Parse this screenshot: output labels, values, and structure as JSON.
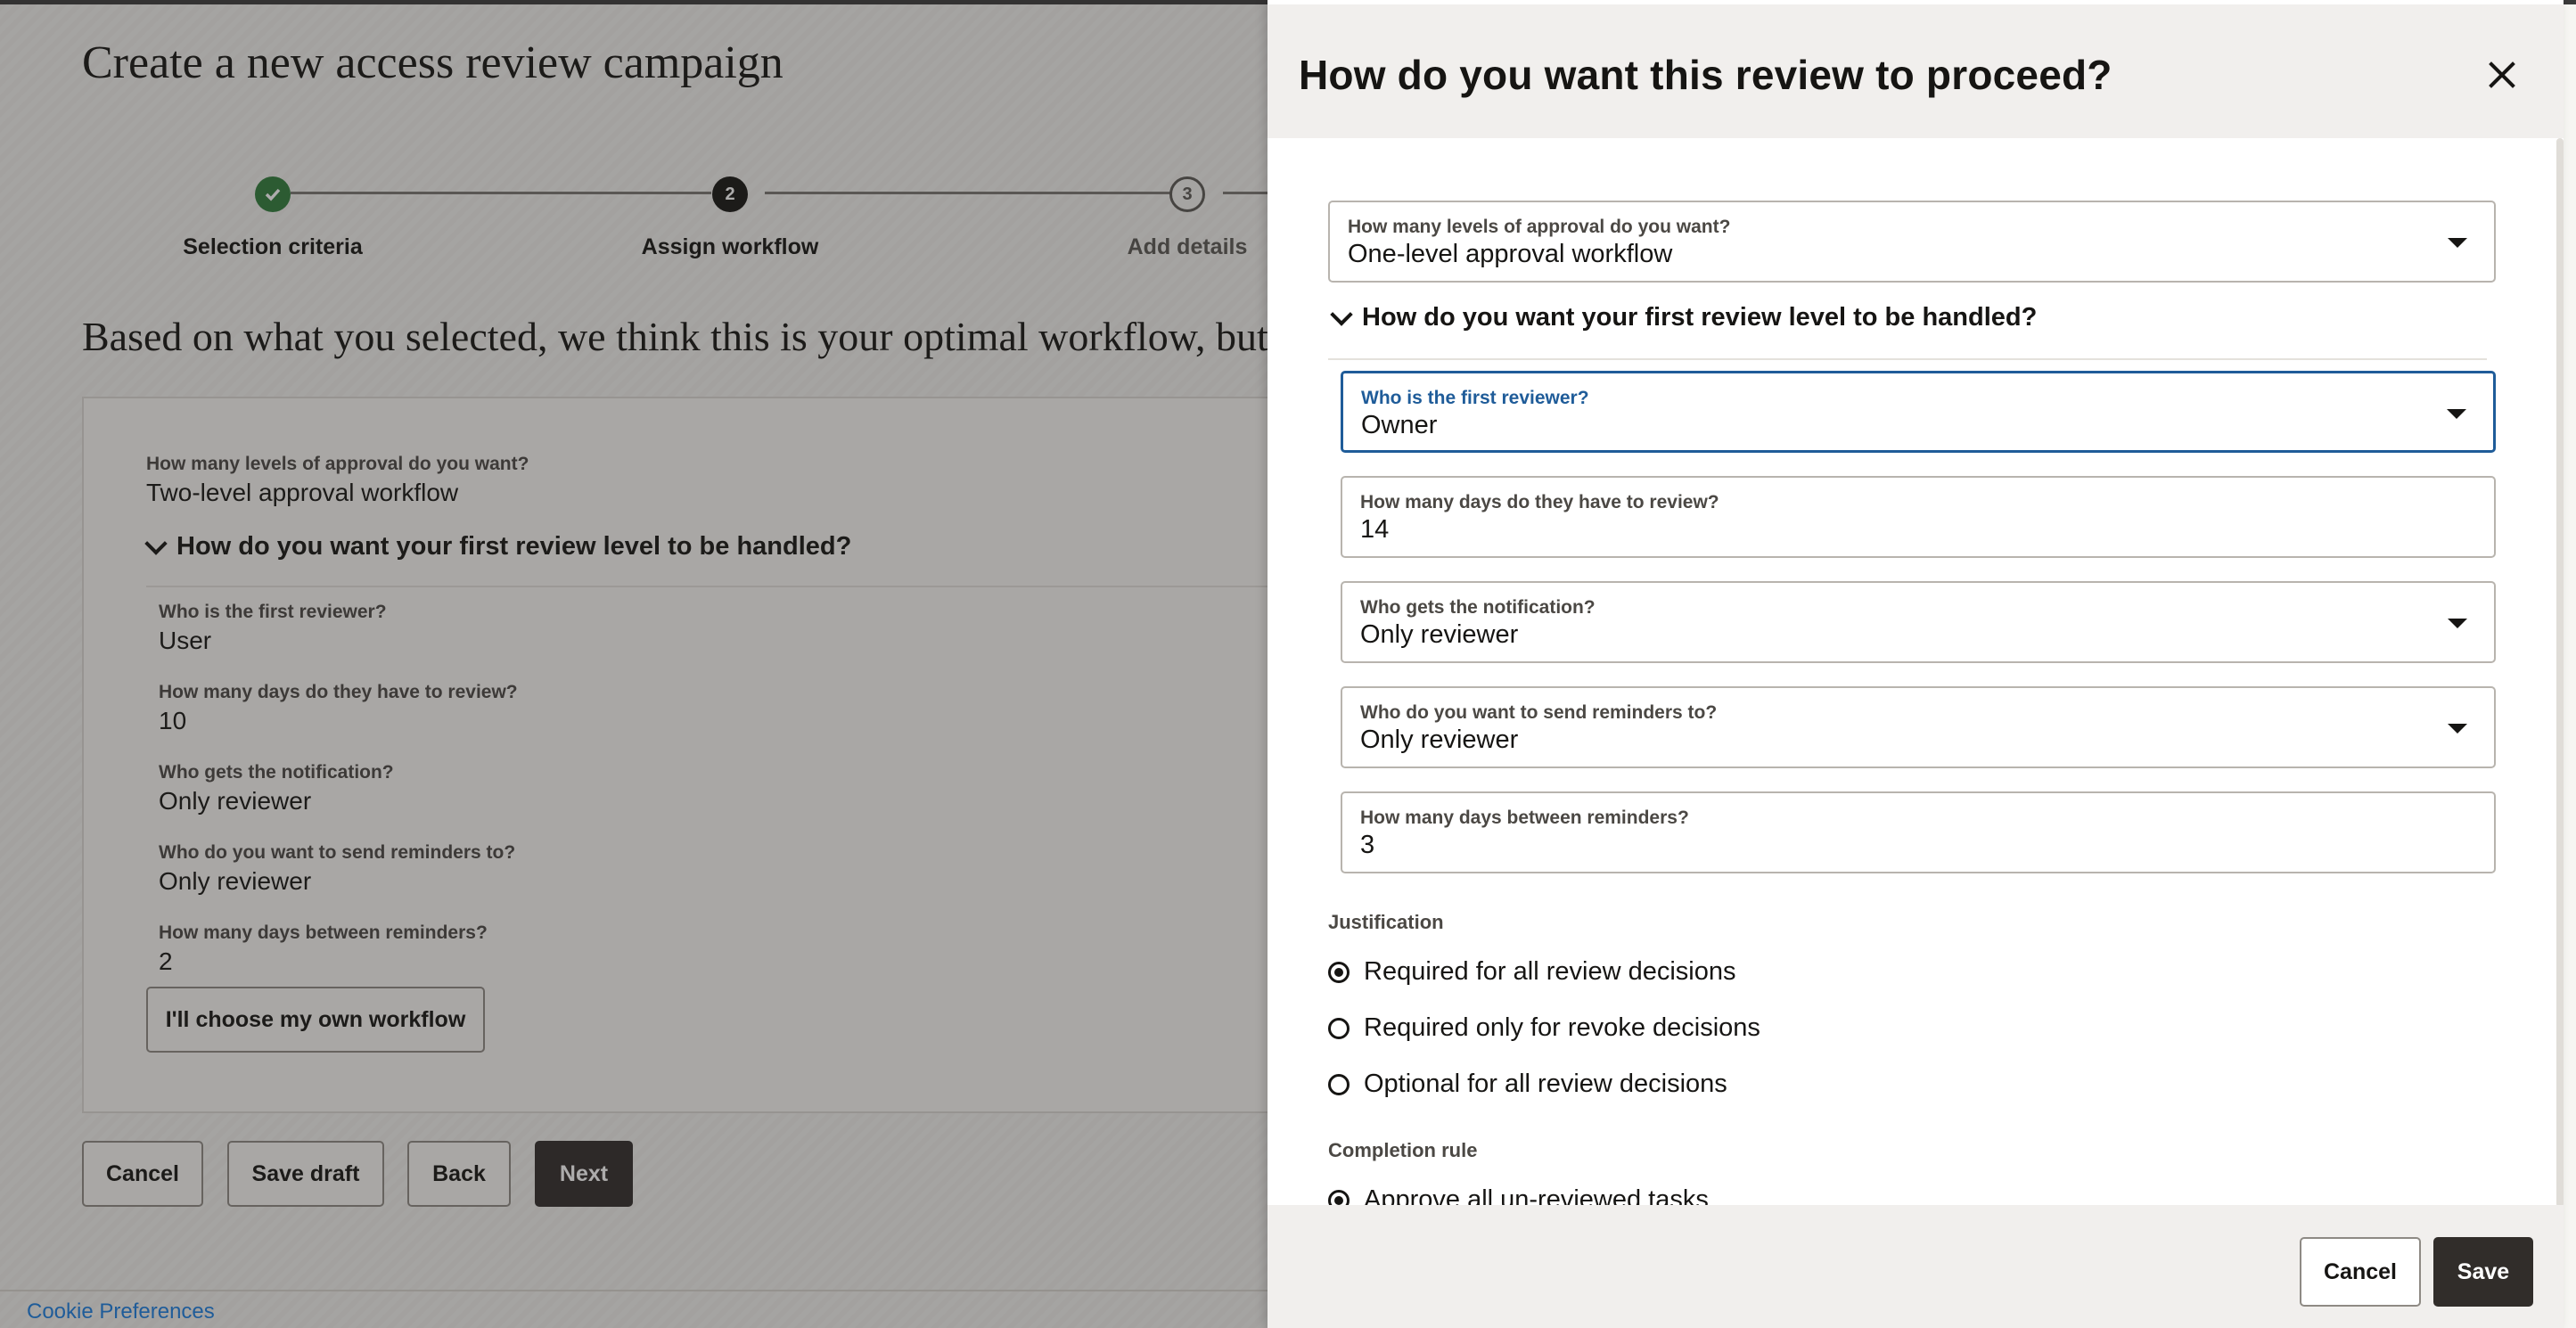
{
  "page": {
    "title": "Create a new access review campaign",
    "steps": [
      {
        "label": "Selection criteria",
        "state": "done",
        "number": ""
      },
      {
        "label": "Assign workflow",
        "state": "current",
        "number": "2"
      },
      {
        "label": "Add details",
        "state": "upcoming",
        "number": "3"
      }
    ],
    "intro": "Based on what you selected, we think this is your optimal workflow, but y",
    "summary": {
      "levels_label": "How many levels of approval do you want?",
      "levels_value": "Two-level approval workflow",
      "section_title": "How do you want your first review level to be handled?",
      "items": [
        {
          "label": "Who is the first reviewer?",
          "value": "User"
        },
        {
          "label": "How many days do they have to review?",
          "value": "10"
        },
        {
          "label": "Who gets the notification?",
          "value": "Only reviewer"
        },
        {
          "label": "Who do you want to send reminders to?",
          "value": "Only reviewer"
        },
        {
          "label": "How many days between reminders?",
          "value": "2"
        }
      ],
      "own_workflow_button": "I'll choose my own workflow"
    },
    "buttons": {
      "cancel": "Cancel",
      "save_draft": "Save draft",
      "back": "Back",
      "next": "Next"
    },
    "cookie_link": "Cookie Preferences"
  },
  "drawer": {
    "title": "How do you want this review to proceed?",
    "levels": {
      "label": "How many levels of approval do you want?",
      "value": "One-level approval workflow"
    },
    "section_title": "How do you want your first review level to be handled?",
    "fields": [
      {
        "label": "Who is the first reviewer?",
        "value": "Owner"
      },
      {
        "label": "How many days do they have to review?",
        "value": "14"
      },
      {
        "label": "Who gets the notification?",
        "value": "Only reviewer"
      },
      {
        "label": "Who do you want to send reminders to?",
        "value": "Only reviewer"
      },
      {
        "label": "How many days between reminders?",
        "value": "3"
      }
    ],
    "justification": {
      "label": "Justification",
      "options": [
        "Required for all review decisions",
        "Required only for revoke decisions",
        "Optional for all review decisions"
      ],
      "selected": 0
    },
    "completion": {
      "label": "Completion rule",
      "options": [
        "Approve all un-reviewed tasks"
      ],
      "selected": 0
    },
    "footer": {
      "cancel": "Cancel",
      "save": "Save"
    }
  },
  "colors": {
    "accent": "#1f5c99",
    "dark_button": "#312d2a",
    "success": "#2f7d3b"
  }
}
